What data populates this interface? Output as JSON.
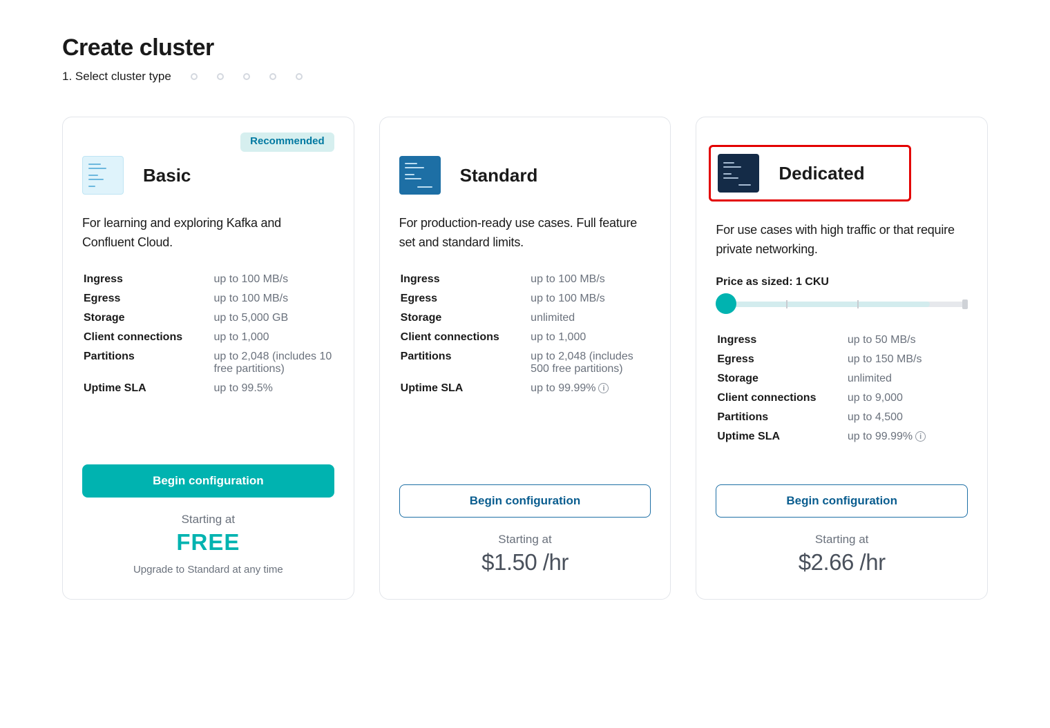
{
  "page": {
    "title": "Create cluster",
    "step_label": "1. Select cluster type"
  },
  "plans": {
    "basic": {
      "badge": "Recommended",
      "title": "Basic",
      "description": "For learning and exploring Kafka and Confluent Cloud.",
      "specs": {
        "ingress_k": "Ingress",
        "ingress_v": "up to 100 MB/s",
        "egress_k": "Egress",
        "egress_v": "up to 100 MB/s",
        "storage_k": "Storage",
        "storage_v": "up to 5,000 GB",
        "conn_k": "Client connections",
        "conn_v": "up to 1,000",
        "part_k": "Partitions",
        "part_v": "up to 2,048 (includes 10 free partitions)",
        "sla_k": "Uptime SLA",
        "sla_v": "up to 99.5%"
      },
      "button": "Begin configuration",
      "price_label": "Starting at",
      "price": "FREE",
      "price_sub": "Upgrade to Standard at any time"
    },
    "standard": {
      "title": "Standard",
      "description": "For production-ready use cases. Full feature set and standard limits.",
      "specs": {
        "ingress_k": "Ingress",
        "ingress_v": "up to 100 MB/s",
        "egress_k": "Egress",
        "egress_v": "up to 100 MB/s",
        "storage_k": "Storage",
        "storage_v": "unlimited",
        "conn_k": "Client connections",
        "conn_v": "up to 1,000",
        "part_k": "Partitions",
        "part_v": "up to 2,048 (includes 500 free partitions)",
        "sla_k": "Uptime SLA",
        "sla_v": "up to 99.99%"
      },
      "button": "Begin configuration",
      "price_label": "Starting at",
      "price": "$1.50 /hr"
    },
    "dedicated": {
      "title": "Dedicated",
      "description": "For use cases with high traffic or that require private networking.",
      "size_label": "Price as sized: 1 CKU",
      "specs": {
        "ingress_k": "Ingress",
        "ingress_v": "up to 50 MB/s",
        "egress_k": "Egress",
        "egress_v": "up to 150 MB/s",
        "storage_k": "Storage",
        "storage_v": "unlimited",
        "conn_k": "Client connections",
        "conn_v": "up to 9,000",
        "part_k": "Partitions",
        "part_v": "up to 4,500",
        "sla_k": "Uptime SLA",
        "sla_v": "up to 99.99%"
      },
      "button": "Begin configuration",
      "price_label": "Starting at",
      "price": "$2.66 /hr"
    }
  }
}
